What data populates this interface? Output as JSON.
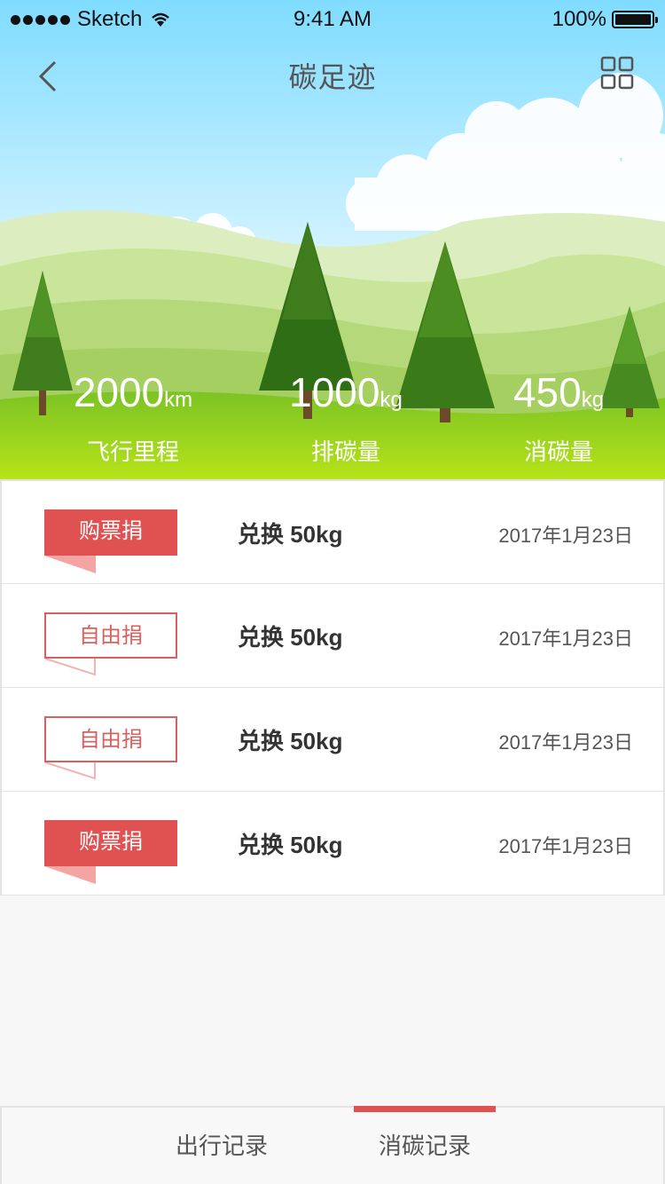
{
  "status_bar": {
    "carrier": "Sketch",
    "time": "9:41 AM",
    "battery": "100%"
  },
  "nav": {
    "title": "碳足迹",
    "back_icon": "chevron-left-icon",
    "menu_icon": "grid-icon"
  },
  "stats": [
    {
      "value": "2000",
      "unit": "km",
      "label": "飞行里程"
    },
    {
      "value": "1000",
      "unit": "kg",
      "label": "排碳量"
    },
    {
      "value": "450",
      "unit": "kg",
      "label": "消碳量"
    }
  ],
  "records": [
    {
      "tag": "购票捐",
      "style": "solid",
      "text": "兑换 50kg",
      "date": "2017年1月23日"
    },
    {
      "tag": "自由捐",
      "style": "outline",
      "text": "兑换 50kg",
      "date": "2017年1月23日"
    },
    {
      "tag": "自由捐",
      "style": "outline",
      "text": "兑换 50kg",
      "date": "2017年1月23日"
    },
    {
      "tag": "购票捐",
      "style": "solid",
      "text": "兑换 50kg",
      "date": "2017年1月23日"
    }
  ],
  "tabs": [
    {
      "label": "出行记录",
      "active": false
    },
    {
      "label": "消碳记录",
      "active": true
    }
  ],
  "colors": {
    "accent": "#e05251",
    "grass": "#9fd322",
    "sky_top": "#7fdcff",
    "tree": "#3f7d1c"
  }
}
